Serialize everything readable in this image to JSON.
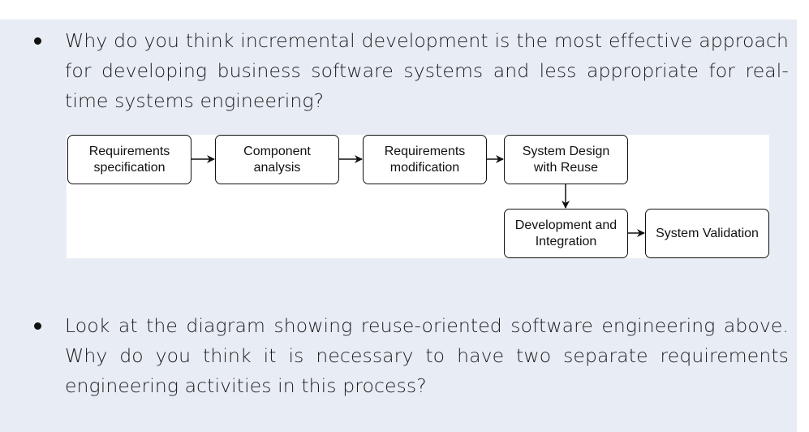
{
  "questions": [
    {
      "text": "Why do you think incremental development is the most effective approach for developing business software systems and less appropriate for real-time systems engineering?"
    },
    {
      "text": "Look at the diagram showing reuse-oriented software engineering above. Why do you think it is necessary to have two separate requirements engineering activities in this process?"
    }
  ],
  "diagram": {
    "nodes": [
      {
        "id": "req-spec",
        "label": "Requirements\nspecification"
      },
      {
        "id": "comp-analysis",
        "label": "Component\nanalysis"
      },
      {
        "id": "req-mod",
        "label": "Requirements\nmodification"
      },
      {
        "id": "sys-design",
        "label": "System Design\nwith Reuse"
      },
      {
        "id": "dev-int",
        "label": "Development and\nIntegration"
      },
      {
        "id": "sys-val",
        "label": "System Validation"
      }
    ],
    "edges": [
      [
        "req-spec",
        "comp-analysis"
      ],
      [
        "comp-analysis",
        "req-mod"
      ],
      [
        "req-mod",
        "sys-design"
      ],
      [
        "sys-design",
        "dev-int"
      ],
      [
        "dev-int",
        "sys-val"
      ]
    ]
  }
}
